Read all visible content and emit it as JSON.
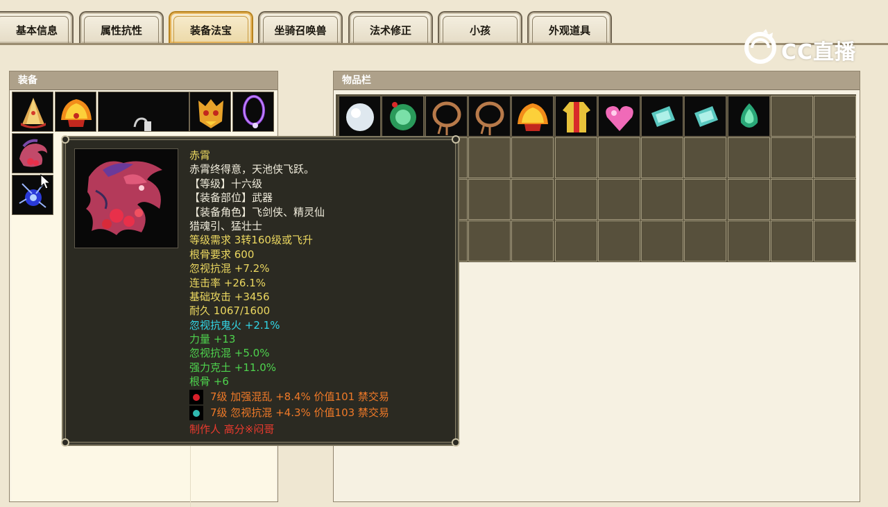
{
  "tabs": [
    {
      "label": "基本信息",
      "active": false
    },
    {
      "label": "属性抗性",
      "active": false
    },
    {
      "label": "装备法宝",
      "active": true
    },
    {
      "label": "坐骑召唤兽",
      "active": false
    },
    {
      "label": "法术修正",
      "active": false
    },
    {
      "label": "小孩",
      "active": false
    },
    {
      "label": "外观道具",
      "active": false
    }
  ],
  "watermark": {
    "text": "CC直播"
  },
  "equipment": {
    "title": "装备"
  },
  "inventory": {
    "title": "物品栏"
  },
  "tooltip": {
    "name": "赤霄",
    "description": "赤霄终得意，天池侠飞跃。",
    "level": "【等级】十六级",
    "slot": "【装备部位】武器",
    "roles": "【装备角色】飞剑侠、精灵仙",
    "roles2": "猎魂引、猛壮士",
    "requirement": "等级需求 3转160级或飞升",
    "bone_req": "根骨要求 600",
    "base_stats": [
      "忽视抗混 +7.2%",
      "连击率 +26.1%",
      "基础攻击 +3456",
      "耐久 1067/1600"
    ],
    "special_stat": "忽视抗鬼火 +2.1%",
    "bonus_stats": [
      "力量 +13",
      "忽视抗混 +5.0%",
      "强力克土 +11.0%",
      "根骨 +6"
    ],
    "gems": [
      {
        "text": "7级 加强混乱 +8.4% 价值101 禁交易",
        "color": "#d8202a"
      },
      {
        "text": "7级 忽视抗混 +4.3% 价值103 禁交易",
        "color": "#2fb8b0"
      }
    ],
    "maker": "制作人 高分※闷哥"
  },
  "colors": {
    "active_tab_border": "#b88420",
    "tooltip_bg": "#2b2a22",
    "name_yellow": "#ecd860",
    "stat_cyan": "#32d6e6",
    "stat_green": "#4ed44e",
    "gem_orange": "#f07a28",
    "maker_red": "#ec3a2e"
  },
  "icons": {
    "equip_slots": [
      "hat-icon",
      "flame-helmet-icon",
      "weapon-silhouette-icon",
      "demon-mask-icon",
      "necklace-icon",
      "dragon-weapon-icon",
      "lightning-orb-icon"
    ],
    "inventory_items": [
      "white-orb-icon",
      "green-orb-icon",
      "rope-ring-icon",
      "rope-ring-icon",
      "flame-helmet-icon",
      "golden-robe-icon",
      "pink-heart-icon",
      "cyan-jade-icon",
      "cyan-jade-icon",
      "green-gem-icon"
    ]
  }
}
